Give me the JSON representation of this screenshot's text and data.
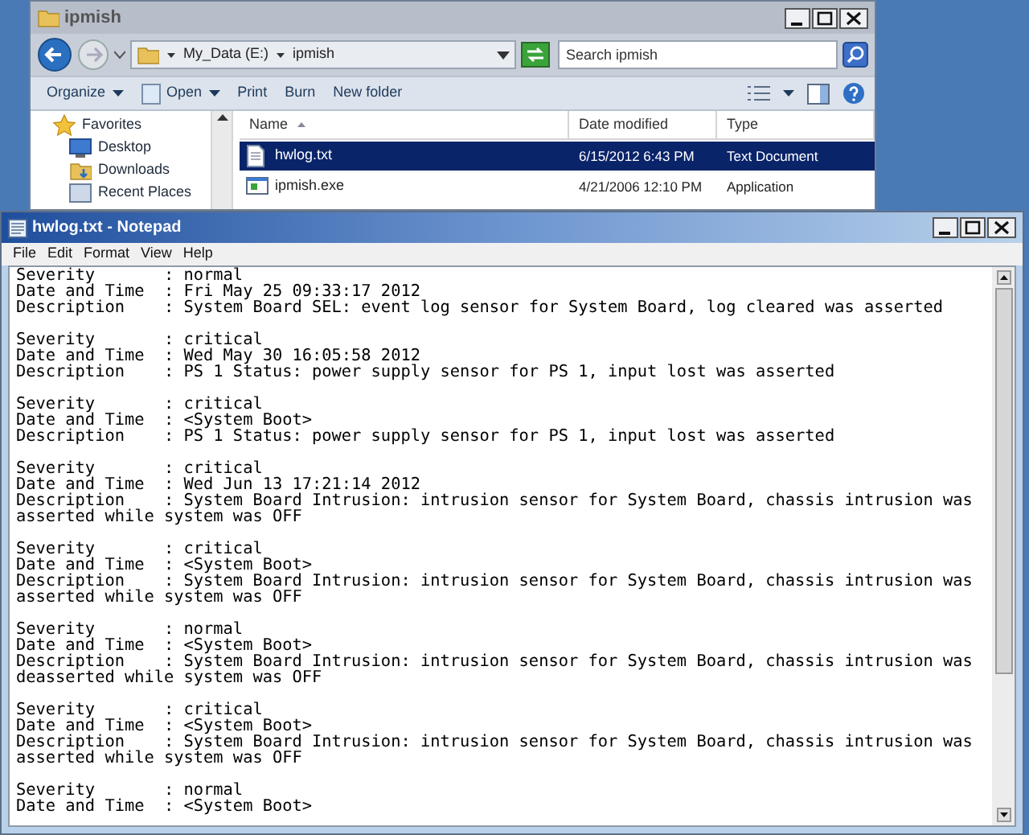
{
  "explorer": {
    "title": "ipmish",
    "breadcrumb": [
      "My_Data (E:)",
      "ipmish"
    ],
    "search": {
      "placeholder": "Search ipmish"
    },
    "toolbar": [
      {
        "label": "Organize",
        "kind": "menu"
      },
      {
        "label": "Open",
        "kind": "menu"
      },
      {
        "label": "Print",
        "kind": "button"
      },
      {
        "label": "Burn",
        "kind": "button"
      },
      {
        "label": "New folder",
        "kind": "button"
      }
    ],
    "nav": [
      {
        "label": "Favorites",
        "kind": "header"
      },
      {
        "label": "Desktop",
        "kind": "desktop"
      },
      {
        "label": "Downloads",
        "kind": "downloads"
      },
      {
        "label": "Recent Places",
        "kind": "recent"
      }
    ],
    "columns": [
      "Name",
      "Date modified",
      "Type"
    ],
    "files": [
      {
        "name": "hwlog.txt",
        "date": "6/15/2012 6:43 PM",
        "type": "Text Document",
        "kind": "text",
        "selected": true
      },
      {
        "name": "ipmish.exe",
        "date": "4/21/2006 12:10 PM",
        "type": "Application",
        "kind": "app",
        "selected": false
      }
    ]
  },
  "notepad": {
    "title": "hwlog.txt - Notepad",
    "menu": [
      "File",
      "Edit",
      "Format",
      "View",
      "Help"
    ],
    "entries": [
      {
        "lines": [
          "Severity       : normal",
          "Date and Time  : Fri May 25 09:33:17 2012",
          "Description    : System Board SEL: event log sensor for System Board, log cleared was asserted"
        ]
      },
      {
        "lines": [
          "Severity       : critical",
          "Date and Time  : Wed May 30 16:05:58 2012",
          "Description    : PS 1 Status: power supply sensor for PS 1, input lost was asserted"
        ]
      },
      {
        "lines": [
          "Severity       : critical",
          "Date and Time  : <System Boot>",
          "Description    : PS 1 Status: power supply sensor for PS 1, input lost was asserted"
        ]
      },
      {
        "lines": [
          "Severity       : critical",
          "Date and Time  : Wed Jun 13 17:21:14 2012",
          "Description    : System Board Intrusion: intrusion sensor for System Board, chassis intrusion was",
          "asserted while system was OFF"
        ]
      },
      {
        "lines": [
          "Severity       : critical",
          "Date and Time  : <System Boot>",
          "Description    : System Board Intrusion: intrusion sensor for System Board, chassis intrusion was",
          "asserted while system was OFF"
        ]
      },
      {
        "lines": [
          "Severity       : normal",
          "Date and Time  : <System Boot>",
          "Description    : System Board Intrusion: intrusion sensor for System Board, chassis intrusion was",
          "deasserted while system was OFF"
        ]
      },
      {
        "lines": [
          "Severity       : critical",
          "Date and Time  : <System Boot>",
          "Description    : System Board Intrusion: intrusion sensor for System Board, chassis intrusion was",
          "asserted while system was OFF"
        ]
      },
      {
        "lines": [
          "Severity       : normal",
          "Date and Time  : <System Boot>"
        ]
      }
    ]
  }
}
